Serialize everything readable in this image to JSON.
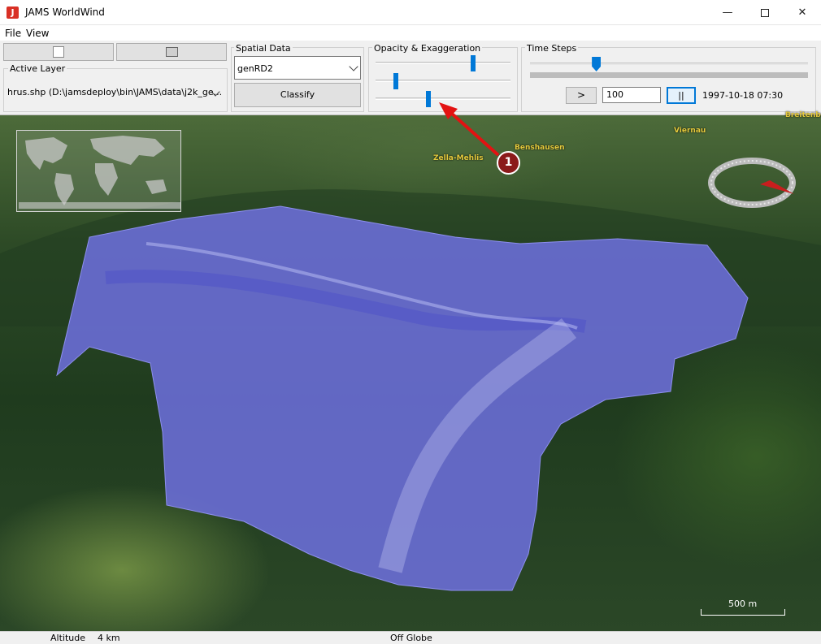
{
  "window": {
    "title": "JAMS WorldWind",
    "min_glyph": "—",
    "close_glyph": "✕"
  },
  "menu": {
    "items": [
      "File",
      "View"
    ]
  },
  "toolbar": {
    "active_layer": {
      "label": "Active Layer",
      "value": "hrus.shp (D:\\jamsdeploy\\bin\\JAMS\\data\\j2k_ge..."
    },
    "spatial_data": {
      "label": "Spatial Data",
      "selected": "genRD2",
      "classify_label": "Classify"
    },
    "opacity": {
      "label": "Opacity & Exaggeration",
      "slider_values": [
        0.73,
        0.14,
        0.39
      ]
    },
    "time_steps": {
      "label": "Time Steps",
      "slider_value": 0.23,
      "play_label": ">",
      "step_value": "100",
      "pause_label": "||",
      "current_time": "1997-10-18 07:30"
    }
  },
  "map": {
    "places": [
      "Zella-Mehlis",
      "Benshausen",
      "Viernau",
      "Breitenbach"
    ],
    "scale_label": "500 m",
    "annotation_number": "1",
    "colors": {
      "layer": "#6e70e0",
      "arrow": "#e31212",
      "badge": "#8b1a1a"
    }
  },
  "status": {
    "altitude_label": "Altitude",
    "altitude_value": "4 km",
    "globe_state": "Off Globe"
  }
}
